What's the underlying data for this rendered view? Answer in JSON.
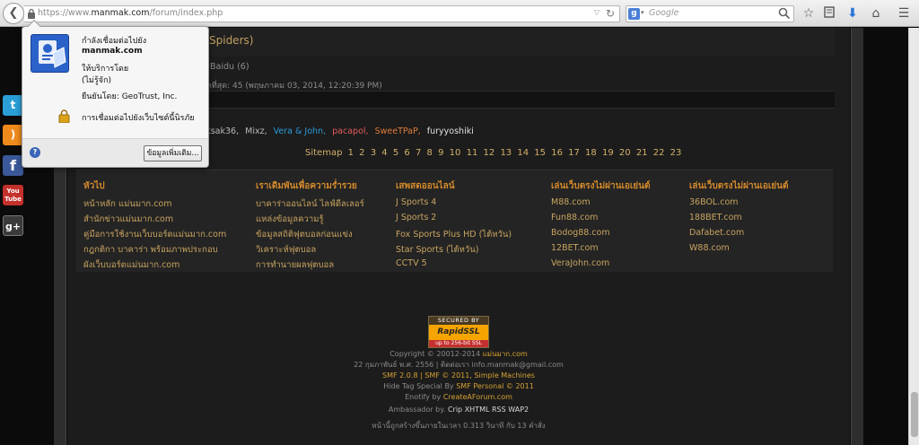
{
  "browser": {
    "url_prefix": "https://www.",
    "url_domain": "manmak.com",
    "url_path": "/forum/index.php",
    "search_engine_letter": "g",
    "search_placeholder": "Google",
    "icons": [
      "back-icon",
      "lock-icon",
      "reload-icon",
      "search-icon",
      "star-icon",
      "reading-list-icon",
      "download-icon",
      "home-icon",
      "menu-icon"
    ]
  },
  "identity_popup": {
    "connecting_to": "กำลังเชื่อมต่อไปยัง",
    "domain": "manmak.com",
    "operated_by": "ให้บริการโดย",
    "operator": "(ไม่รู้จัก)",
    "verified_by": "ยืนยันโดย: GeoTrust, Inc.",
    "encryption": "การเชื่อมต่อไปยังเว็บไซต์นี้นิรภัย",
    "more_info_button": "ข้อมูลเพิ่มเติม...",
    "help_glyph": "?"
  },
  "forum": {
    "spiders_text": "Spiders)",
    "baidu_text": ", Baidu (6)",
    "latest_text": "ุดที่สุด: 45 (พฤษภาคม 03, 2014, 12:20:39 PM)",
    "online_users": [
      {
        "name": "tsak36,",
        "color": "#b9b9b9"
      },
      {
        "name": "Mixz,",
        "color": "#b9b9b9"
      },
      {
        "name": "Vera & John,",
        "color": "#2b9ad8"
      },
      {
        "name": "pacapol,",
        "color": "#e25a5a"
      },
      {
        "name": "SweeTPaP,",
        "color": "#e07a3a"
      },
      {
        "name": "furyyoshiki",
        "color": "#e0e0e0"
      }
    ],
    "sitemap_label": "Sitemap",
    "sitemap_pages": [
      "1",
      "2",
      "3",
      "4",
      "5",
      "6",
      "7",
      "8",
      "9",
      "10",
      "11",
      "12",
      "13",
      "14",
      "15",
      "16",
      "17",
      "18",
      "19",
      "20",
      "21",
      "22",
      "23"
    ]
  },
  "footer_columns": [
    {
      "title": "หัวไป",
      "links": [
        "หน้าหลัก แม่นมาก.com",
        "สำนักข่าวแม่นมาก.com",
        "คู่มือการใช้งานเว็บบอร์ดแม่นมาก.com",
        "กฎกติกา บาคาร่า พร้อมภาพประกอบ",
        "ผังเว็บบอร์ดแม่นมาก.com"
      ]
    },
    {
      "title": "เราเดิมพันเพื่อความร่ำรวย",
      "links": [
        "บาคาร่าออนไลน์ ไลฟ์ดีลเลอร์",
        "แหล่งข้อมูลความรู้",
        "ข้อมูลสถิติฟุตบอลก่อนแข่ง",
        "วิเคราะห์ฟุตบอล",
        "การทำนายผลฟุตบอล"
      ]
    },
    {
      "title": "เสพสดออนไลน์",
      "links": [
        "J Sports 4",
        "J Sports 2",
        "Fox Sports Plus HD (ไต้หวัน)",
        "Star Sports (ไต้หวัน)",
        "CCTV 5"
      ]
    },
    {
      "title": "เล่นเว็บตรงไม่ผ่านเอเย่นต์",
      "links": [
        "M88.com",
        "Fun88.com",
        "Bodog88.com",
        "12BET.com",
        "VeraJohn.com"
      ]
    },
    {
      "title": "เล่นเว็บตรงไม่ผ่านเอเย่นต์",
      "links": [
        "36BOL.com",
        "188BET.com",
        "Dafabet.com",
        "W88.com"
      ]
    }
  ],
  "ssl_badge": {
    "top": "SECURED BY",
    "brand": "RapidSSL",
    "bottom": "up to 256-bit SSL"
  },
  "credits": {
    "copyright_prefix": "Copyright © 20012-2014",
    "copyright_site": "แม่นมาก.com",
    "contact": "22 กุมภาพันธ์ พ.ศ. 2556  |  ติดต่อเรา info.manmak@gmail.com",
    "smf": "SMF 2.0.8 | SMF © 2011, Simple Machines",
    "hide_tag_prefix": "Hide Tag Special By",
    "hide_tag_link": "SMF Personal © 2011",
    "enotify_prefix": "Enotify by",
    "enotify_link": "CreateAForum.com",
    "ambassador_prefix": "Ambassador by.",
    "ambassador_links": [
      "Crip",
      "XHTML",
      "RSS",
      "WAP2"
    ],
    "timing": "หน้านี้ถูกสร้างขึ้นภายในเวลา 0.313 วินาที กับ 13 คำสั่ง"
  },
  "share": {
    "twitter": "t",
    "rss": ")",
    "facebook": "f",
    "youtube": "You Tube",
    "googleplus": "g+"
  },
  "colors": {
    "accent_orange": "#d38a2c",
    "link_gold": "#c8a460",
    "popup_bg": "#f6f6f6",
    "page_bg": "#1c1c1c"
  }
}
